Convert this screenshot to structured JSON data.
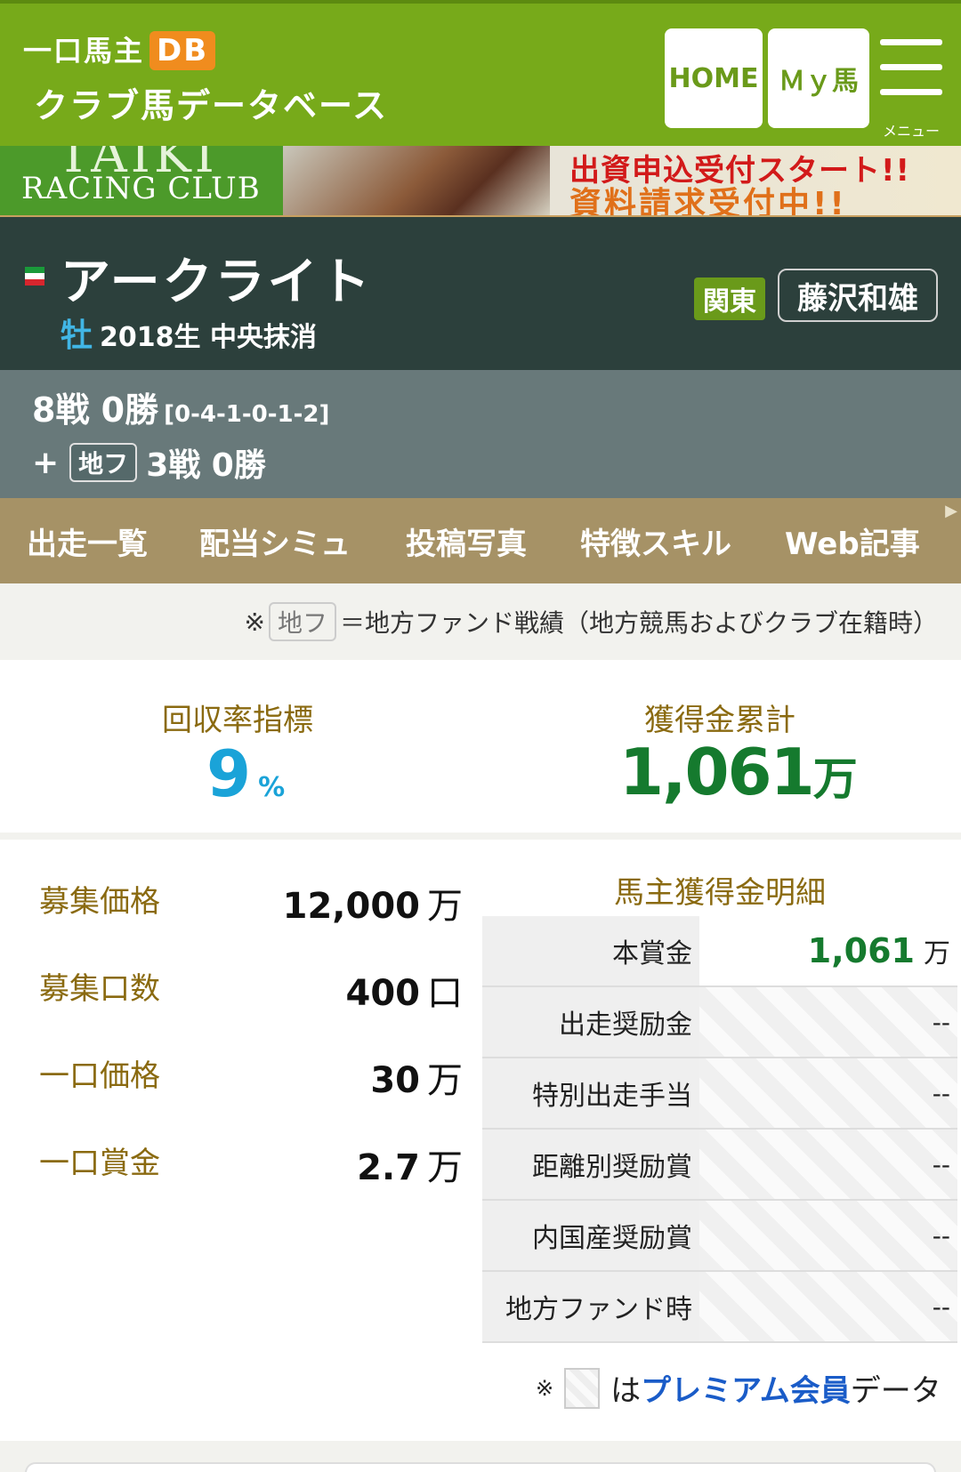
{
  "header": {
    "logo_line1": "一口馬主",
    "logo_badge": "DB",
    "logo_line2": "クラブ馬データベース",
    "home_label": "HOME",
    "myuma_label": "Ｍｙ馬",
    "menu_label": "メニュー"
  },
  "banner": {
    "club_top": "TAIKI",
    "club_bottom": "RACING CLUB",
    "text1": "出資申込受付スタート!!",
    "text2": "資料請求受付中!!"
  },
  "horse": {
    "name": "アークライト",
    "sex": "牡",
    "info": "2018生 中央抹消",
    "region": "関東",
    "trainer": "藤沢和雄",
    "flag_colors": [
      "#1a9a3a",
      "#ffffff",
      "#d8262e"
    ]
  },
  "record": {
    "main": "8戦 0勝",
    "detail": "[0-4-1-0-1-2]",
    "plus": "+",
    "chiho_label": "地フ",
    "chiho_record": "3戦 0勝"
  },
  "tabs": [
    "出走一覧",
    "配当シミュ",
    "投稿写真",
    "特徴スキル",
    "Web記事"
  ],
  "note": {
    "mark": "※",
    "chiho_label": "地フ",
    "text": "＝地方ファンド戦績（地方競馬およびクラブ在籍時）"
  },
  "stats": {
    "roi_label": "回収率指標",
    "roi_value": "9",
    "roi_unit": "%",
    "earnings_label": "獲得金累計",
    "earnings_value": "1,061",
    "earnings_unit": "万"
  },
  "details": [
    {
      "label": "募集価格",
      "value": "12,000",
      "unit": "万"
    },
    {
      "label": "募集口数",
      "value": "400",
      "unit": "口"
    },
    {
      "label": "一口価格",
      "value": "30",
      "unit": "万"
    },
    {
      "label": "一口賞金",
      "value": "2.7",
      "unit": "万"
    }
  ],
  "owner_table": {
    "title": "馬主獲得金明細",
    "rows": [
      {
        "label": "本賞金",
        "value": "1,061",
        "unit": "万"
      },
      {
        "label": "出走奨励金",
        "value": "--"
      },
      {
        "label": "特別出走手当",
        "value": "--"
      },
      {
        "label": "距離別奨励賞",
        "value": "--"
      },
      {
        "label": "内国産奨励賞",
        "value": "--"
      },
      {
        "label": "地方ファンド時",
        "value": "--"
      }
    ]
  },
  "premium_note": {
    "mark": "※",
    "prefix": "は",
    "link": "プレミアム会員",
    "suffix": "データ"
  },
  "colors": {
    "header_green": "#77aa1a",
    "horse_bg": "#2c403c",
    "record_bg": "#68797a",
    "tab_bg": "#a69266",
    "roi_blue": "#1aa3d8",
    "earnings_green": "#157a2e",
    "label_brown": "#8a6a10"
  }
}
